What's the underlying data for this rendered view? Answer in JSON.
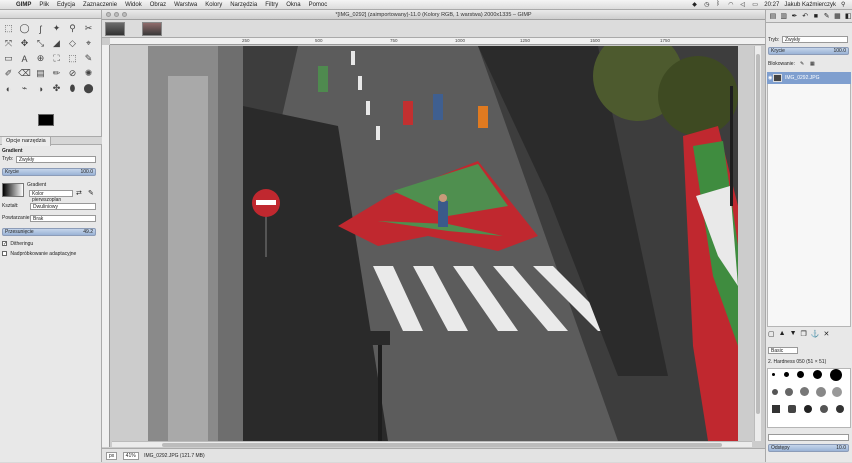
{
  "menubar": {
    "apple": "",
    "items": [
      "GIMP",
      "Plik",
      "Edycja",
      "Zaznaczenie",
      "Widok",
      "Obraz",
      "Warstwa",
      "Kolory",
      "Narzędzia",
      "Filtry",
      "Okna",
      "Pomoc"
    ],
    "clock": "20:27",
    "user": "Jakub Kaźmierczyk"
  },
  "window": {
    "title": "*[IMG_0292] (zaimportowany)-11.0 (Kolory RGB, 1 warstwa) 2000x1335 – GIMP"
  },
  "ruler": {
    "ticks": [
      "250",
      "500",
      "750",
      "1000",
      "1250",
      "1500",
      "1750"
    ]
  },
  "toolbox": {
    "tools": [
      "⬚",
      "◯",
      "ʃ",
      "✦",
      "⚲",
      "✂",
      "⤧",
      "✥",
      "⤡",
      "◢",
      "◇",
      "⌖",
      "▭",
      "A",
      "⊕",
      "⛶",
      "⬚",
      "✎",
      "✐",
      "⌫",
      "▤",
      "✏",
      "⊘",
      "✺",
      "◐",
      "⌁",
      "◑",
      "✤",
      "⬮",
      "⬤"
    ],
    "tab_label": "Opcje narzędzia",
    "tool_name": "Gradient",
    "mode_label": "Tryb:",
    "mode_value": "Zwykły",
    "opacity_label": "Krycie",
    "opacity_value": "100.0",
    "gradient_label": "Gradient",
    "gradient_value": "Kolor pierwszoplan",
    "shape_label": "Kształt:",
    "shape_value": "Dwuliniowy",
    "repeat_label": "Powtarzanie:",
    "repeat_value": "Brak",
    "offset_label": "Przesunięcie",
    "offset_value": "49.2",
    "dithering_label": "Ditheringu",
    "adaptive_label": "Nadpróbkowanie adaptacyjne"
  },
  "status": {
    "unit": "px",
    "zoom": "41%",
    "file": "IMG_0292.JPG (121.7 MB)"
  },
  "dock": {
    "mode_label": "Tryb:",
    "mode_value": "Zwykły",
    "opacity_label": "Krycie",
    "opacity_value": "100.0",
    "lock_label": "Blokowanie:",
    "layer_name": "IMG_0292.JPG",
    "brush_mode_value": "Basic",
    "brush_name": "2. Hardness 050 (51 × 51)",
    "spacing_label": "Odstępy",
    "spacing_value": "10.0"
  }
}
